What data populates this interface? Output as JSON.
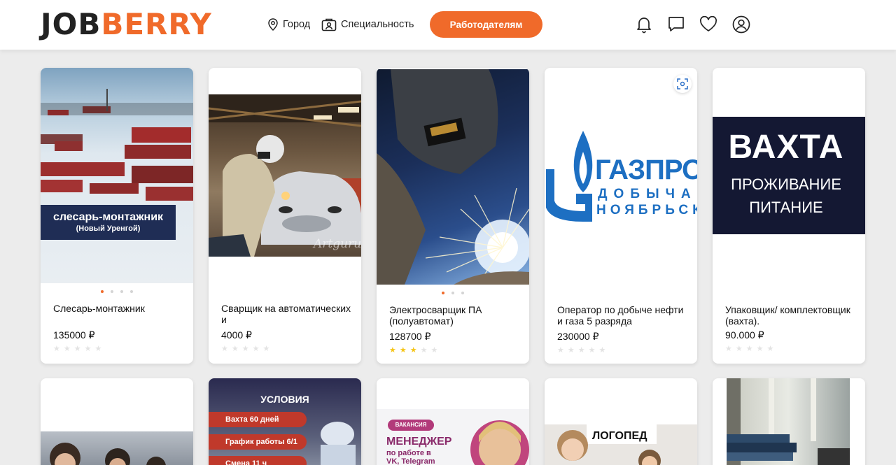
{
  "header": {
    "logo": {
      "part1": "JOB",
      "part2": "BERRY"
    },
    "city_label": "Город",
    "specialty_label": "Специальность",
    "employers_button": "Работодателям",
    "icons": [
      "bell-icon",
      "chat-icon",
      "heart-icon",
      "user-icon"
    ]
  },
  "colors": {
    "accent": "#f06a2a",
    "star": "#f5c518"
  },
  "cards": [
    {
      "title": "Слесарь-монтажник",
      "price": "135000 ₽",
      "rating": 0,
      "dots": 4,
      "active_dot": 0,
      "image": {
        "caption": "слесарь-монтажник",
        "sub": "(Новый Уренгой)"
      }
    },
    {
      "title": "Сварщик на автоматических и",
      "price": "4000 ₽",
      "rating": 0,
      "dots": 0,
      "image": {
        "watermark": "Artguru"
      }
    },
    {
      "title": "Электросварщик ПА (полуавтомат)",
      "price": "128700 ₽",
      "rating": 3,
      "dots": 3,
      "active_dot": 0
    },
    {
      "title": "Оператор по добыче нефти и газа 5 разряда",
      "price": "230000 ₽",
      "rating": 0,
      "dots": 0,
      "image": {
        "line1": "ГАЗПРОМ",
        "line2": "ДОБЫЧА",
        "line3": "НОЯБРЬСК"
      }
    },
    {
      "title": "Упаковщик/ комплектовщик (вахта).",
      "price": "90.000 ₽",
      "rating": 0,
      "dots": 0,
      "image": {
        "line1": "ВАХТА",
        "line2": "ПРОЖИВАНИЕ",
        "line3": "ПИТАНИЕ"
      }
    }
  ],
  "cards_row2": [
    {
      "image": {}
    },
    {
      "image": {
        "heading": "УСЛОВИЯ",
        "items": [
          "Вахта 60 дней",
          "График работы 6/1",
          "Смена 11 ч"
        ]
      }
    },
    {
      "image": {
        "badge": "ВАКАНСИЯ",
        "heading": "МЕНЕДЖЕР",
        "sub": "по работе в VK, Telegram"
      }
    },
    {
      "image": {
        "heading": "ЛОГОПЕД"
      }
    },
    {
      "image": {}
    }
  ]
}
